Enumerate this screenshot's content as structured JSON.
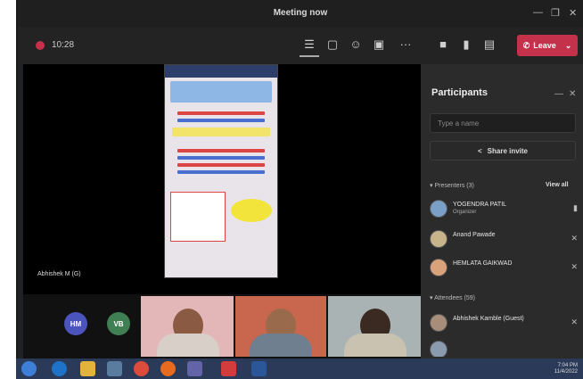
{
  "window": {
    "title": "Meeting now",
    "controls": [
      "—",
      "❐",
      "✕"
    ]
  },
  "toolbar": {
    "timer": "10:28",
    "leave_label": "Leave"
  },
  "stage": {
    "presenter_name": "Abhishek M (G)"
  },
  "participants": {
    "title": "Participants",
    "search_placeholder": "Type a name",
    "share_invite_label": "Share invite",
    "presenters_header": "Presenters (3)",
    "view_all_label": "View all",
    "attendees_header": "Attendees (59)",
    "presenters": [
      {
        "name": "YOGENDRA PATIL",
        "role": "Organizer"
      },
      {
        "name": "Anand Pawade",
        "role": ""
      },
      {
        "name": "HEMLATA GAIKWAD",
        "role": ""
      }
    ],
    "attendees": [
      {
        "name": "Abhishek Kamble (Guest)",
        "role": ""
      }
    ]
  },
  "video_strip": {
    "bubbles": [
      {
        "initials": "HM",
        "color": "#4b53bc"
      },
      {
        "initials": "VB",
        "color": "#3f7f53"
      }
    ]
  },
  "taskbar": {
    "time": "7:04 PM",
    "date": "11/4/2022"
  },
  "colors": {
    "accent_leave": "#c4314b",
    "panel_bg": "#2b2b2b",
    "stage_bg": "#000000"
  }
}
